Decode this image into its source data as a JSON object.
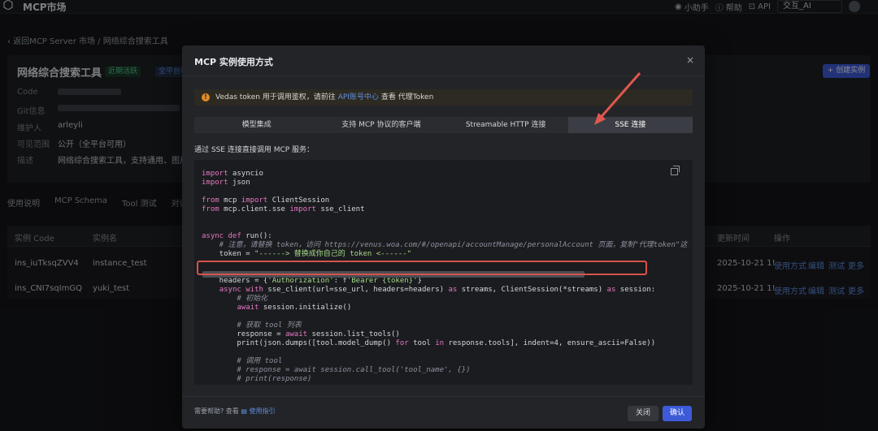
{
  "app": {
    "title": "MCP市场"
  },
  "topbar": {
    "assistant": "小助手",
    "help": "帮助",
    "api": "API",
    "select_value": "交互_AI"
  },
  "breadcrumb": {
    "back": "返回MCP Server 市场",
    "sep": "/",
    "current": "网络综合搜索工具"
  },
  "detail": {
    "title": "网络综合搜索工具",
    "badge_status": "近期活跃",
    "badge_scope": "全平台可用",
    "create_button": "+ 创建实例",
    "rows": [
      {
        "label": "Code",
        "value": ""
      },
      {
        "label": "Git信息",
        "value": ""
      },
      {
        "label": "维护人",
        "value": "arleyli"
      },
      {
        "label": "可见范围",
        "value": "公开（全平台可用）"
      },
      {
        "label": "描述",
        "value": "网络综合搜索工具，支持通用、图片、"
      }
    ]
  },
  "tabs": [
    "使用说明",
    "MCP Schema",
    "Tool 测试",
    "对话测试"
  ],
  "table": {
    "headers": [
      "实例 Code",
      "实例名",
      "更新时间",
      "操作"
    ],
    "rows": [
      {
        "code": "ins_iuTksqZVV4",
        "name": "instance_test",
        "time": "2025-10-21 1!",
        "actions": [
          "使用方式",
          "编辑",
          "测试",
          "更多"
        ]
      },
      {
        "code": "ins_CNI7sqImGQ",
        "name": "yuki_test",
        "time": "2025-10-21 1!",
        "actions": [
          "使用方式",
          "编辑",
          "测试",
          "更多"
        ]
      }
    ]
  },
  "modal": {
    "title": "MCP 实例使用方式",
    "close": "×",
    "alert_prefix": "Vedas token 用于调用鉴权，请前往",
    "alert_link": "API账号中心",
    "alert_suffix": "查看 代理Token",
    "tabs": [
      "模型集成",
      "支持 MCP 协议的客户端",
      "Streamable HTTP 连接",
      "SSE 连接"
    ],
    "active_tab": "SSE 连接",
    "description": "通过 SSE 连接直接调用 MCP 服务：",
    "code_lines": [
      "import asyncio",
      "import json",
      "",
      "from mcp import ClientSession",
      "from mcp.client.sse import sse_client",
      "",
      "",
      "async def run():",
      "    # 注意，请替换 token，访问 https://venus.woa.com/#/openapi/accountManage/personalAccount 页面，复制\"代理token\"这",
      "    token = \"------> 替换成你自己的 token <------\"",
      "",
      "",
      "    headers = {'Authorization': f'Bearer {token}'}",
      "    async with sse_client(url=sse_url, headers=headers) as streams, ClientSession(*streams) as session:",
      "        # 初始化",
      "        await session.initialize()",
      "",
      "        # 获取 tool 列表",
      "        response = await session.list_tools()",
      "        print(json.dumps([tool.model_dump() for tool in response.tools], indent=4, ensure_ascii=False))",
      "",
      "        # 调用 tool",
      "        # response = await session.call_tool('tool_name', {})",
      "        # print(response)"
    ],
    "help_prefix": "需要帮助? 查看",
    "help_link": "使用指引",
    "btn_close": "关闭",
    "btn_ok": "确认"
  },
  "colors": {
    "accent": "#3d5bd9",
    "link": "#5f8fe3",
    "highlight": "#d6534a"
  }
}
